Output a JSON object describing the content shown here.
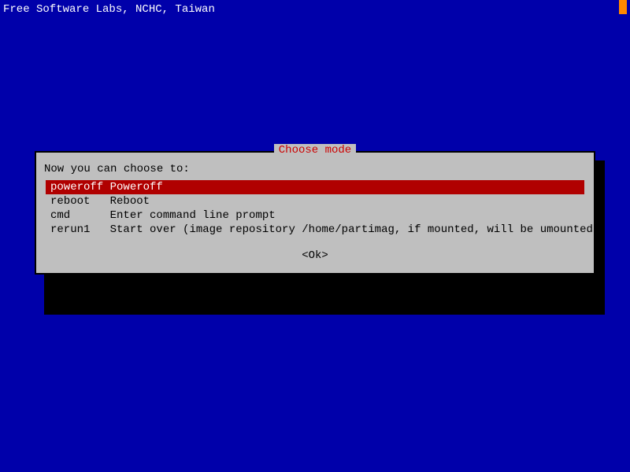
{
  "header": {
    "text": "Free Software Labs, NCHC, Taiwan"
  },
  "dialog": {
    "title": "Choose mode",
    "prompt": "Now you can choose to:",
    "items": {
      "0": {
        "key": "poweroff",
        "desc": "Poweroff"
      },
      "1": {
        "key": "reboot  ",
        "desc": "Reboot"
      },
      "2": {
        "key": "cmd     ",
        "desc": "Enter command line prompt"
      },
      "3": {
        "key": "rerun1  ",
        "desc": "Start over (image repository /home/partimag, if mounted, will be umounted)"
      }
    },
    "ok_label": "<Ok>"
  }
}
